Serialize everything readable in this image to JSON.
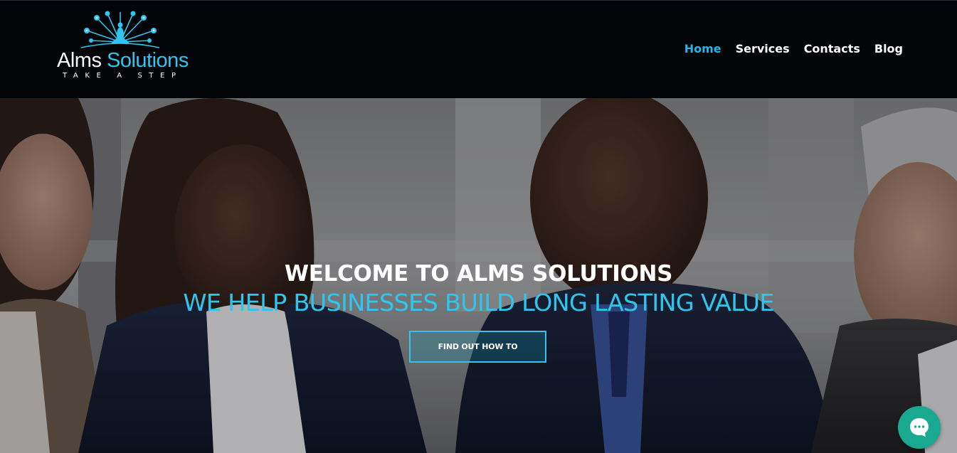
{
  "header": {
    "logo": {
      "name_part1": "Alms",
      "name_part2": "Solutions",
      "tagline": "TAKE A STEP",
      "icon": "peacock-logo-icon"
    },
    "nav": [
      {
        "label": "Home",
        "active": true
      },
      {
        "label": "Services",
        "active": false
      },
      {
        "label": "Contacts",
        "active": false
      },
      {
        "label": "Blog",
        "active": false
      }
    ]
  },
  "hero": {
    "title": "WELCOME TO ALMS SOLUTIONS",
    "subtitle": "WE HELP BUSINESSES BUILD LONG LASTING VALUE",
    "cta_label": "FIND OUT HOW TO",
    "background": "business-meeting-photo"
  },
  "chat": {
    "icon": "chat-bubble-icon"
  },
  "colors": {
    "header_bg": "#030407",
    "accent": "#22b8e6",
    "cta_border": "#33c4ea",
    "chat_bg": "#19a990"
  }
}
